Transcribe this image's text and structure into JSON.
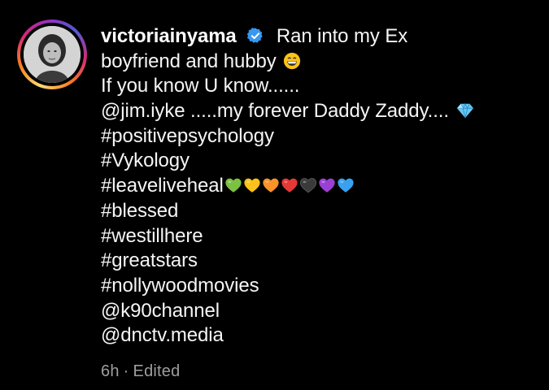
{
  "post": {
    "username": "victoriainyama",
    "verified": true,
    "caption_first": "Ran into my Ex",
    "line2": "boyfriend and hubby",
    "line3": "If you know U know......",
    "mention_jim": "@jim.iyke",
    "line4_rest": " .....my forever Daddy Zaddy....",
    "hashtags_a": [
      "#positivepsychology",
      "#Vykology"
    ],
    "hashtag_leave": "#leaveliveheal",
    "hashtags_b": [
      "#blessed",
      "#westillhere",
      "#greatstars",
      "#nollywoodmovies"
    ],
    "mentions": [
      "@k90channel",
      "@dnctv.media"
    ],
    "emojis": {
      "line2": "grinning-face-emoji",
      "line4": "gem-stone-emoji",
      "hearts": [
        "green-heart",
        "yellow-heart",
        "orange-heart",
        "red-heart",
        "black-heart",
        "purple-heart",
        "blue-heart"
      ]
    },
    "heart_colors": [
      "#7cc142",
      "#fcc21b",
      "#f79329",
      "#e53935",
      "#3a3a3a",
      "#9c40d4",
      "#3aa0f0"
    ]
  },
  "meta": {
    "time": "6h",
    "separator": "·",
    "status": "Edited"
  },
  "colors": {
    "background": "#000000",
    "text": "#f5f5f5",
    "meta": "#9e9e9e",
    "verified": "#3897f0"
  }
}
